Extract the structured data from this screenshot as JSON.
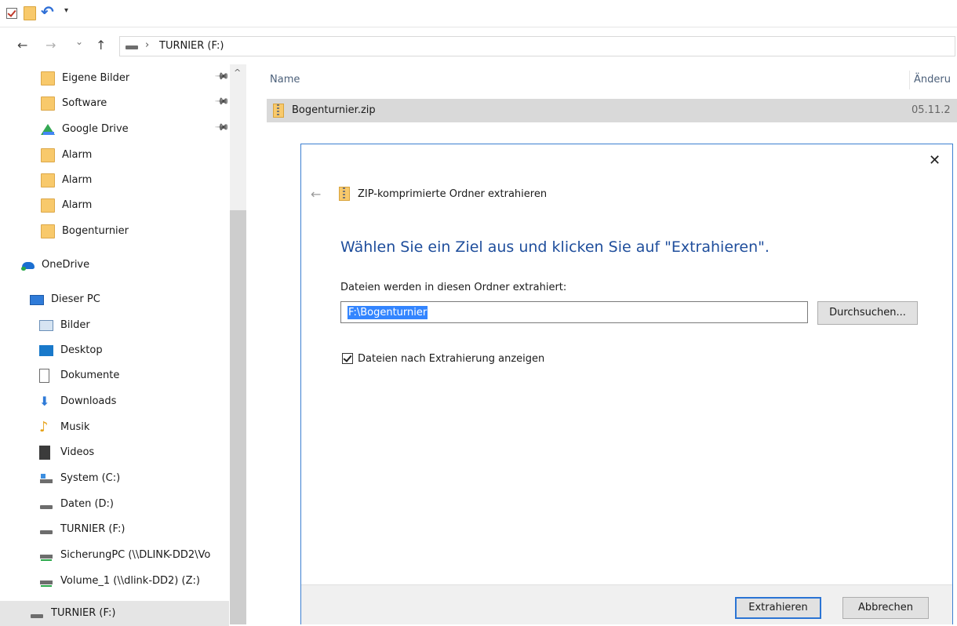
{
  "address": {
    "path": "TURNIER (F:)",
    "separator": "›"
  },
  "nav": {
    "back": "←",
    "forward": "→",
    "dropdown": "⌄",
    "up": "↑"
  },
  "sidebar": {
    "items": [
      {
        "label": "Eigene Bilder",
        "icon": "folder-icon",
        "pinned": true
      },
      {
        "label": "Software",
        "icon": "folder-icon",
        "pinned": true
      },
      {
        "label": "Google Drive",
        "icon": "google-drive-icon",
        "pinned": true
      },
      {
        "label": "Alarm",
        "icon": "folder-icon"
      },
      {
        "label": "Alarm",
        "icon": "folder-icon"
      },
      {
        "label": "Alarm",
        "icon": "folder-icon"
      },
      {
        "label": "Bogenturnier",
        "icon": "folder-icon"
      },
      {
        "label": "OneDrive",
        "icon": "onedrive-icon"
      },
      {
        "label": "Dieser PC",
        "icon": "computer-icon"
      },
      {
        "label": "Bilder",
        "icon": "pictures-icon"
      },
      {
        "label": "Desktop",
        "icon": "desktop-icon"
      },
      {
        "label": "Dokumente",
        "icon": "documents-icon"
      },
      {
        "label": "Downloads",
        "icon": "download-icon"
      },
      {
        "label": "Musik",
        "icon": "music-icon"
      },
      {
        "label": "Videos",
        "icon": "videos-icon"
      },
      {
        "label": "System (C:)",
        "icon": "system-drive-icon"
      },
      {
        "label": "Daten (D:)",
        "icon": "drive-icon"
      },
      {
        "label": "TURNIER (F:)",
        "icon": "drive-icon"
      },
      {
        "label": "SicherungPC (\\\\DLINK-DD2\\Vo",
        "icon": "network-drive-icon"
      },
      {
        "label": "Volume_1 (\\\\dlink-DD2) (Z:)",
        "icon": "network-drive-icon"
      },
      {
        "label": "TURNIER (F:)",
        "icon": "drive-icon",
        "selected": true
      }
    ]
  },
  "list": {
    "columns": {
      "name": "Name",
      "changed": "Änderu"
    },
    "files": [
      {
        "name": "Bogenturnier.zip",
        "date": "05.11.2"
      }
    ]
  },
  "dialog": {
    "close": "✕",
    "back": "←",
    "title": "ZIP-komprimierte Ordner extrahieren",
    "instruction": "Wählen Sie ein Ziel aus und klicken Sie auf \"Extrahieren\".",
    "target_label": "Dateien werden in diesen Ordner extrahiert:",
    "target_value": "F:\\Bogenturnier",
    "browse": "Durchsuchen...",
    "show_files_label": "Dateien nach Extrahierung anzeigen",
    "show_files_checked": true,
    "extract": "Extrahieren",
    "cancel": "Abbrechen"
  },
  "colors": {
    "accent": "#3c7fd1",
    "instruction": "#1f4e9c",
    "selection": "#3385ff"
  }
}
